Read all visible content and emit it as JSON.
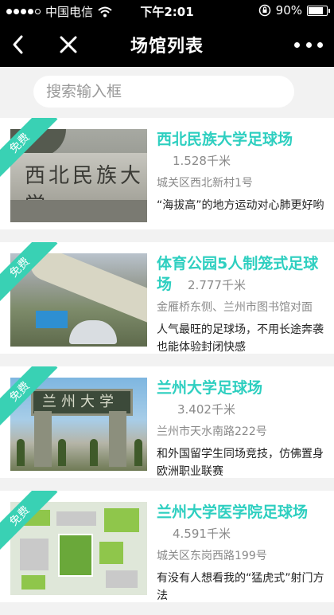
{
  "status_bar": {
    "carrier": "中国电信",
    "time": "下午2:01",
    "battery": "90%",
    "battery_level": 0.9
  },
  "nav": {
    "title": "场馆列表",
    "back_icon": "chevron-left-icon",
    "close_icon": "close-icon",
    "more_icon": "more-dots-icon"
  },
  "search": {
    "placeholder": "搜索输入框"
  },
  "colors": {
    "accent": "#2ecfc0",
    "ribbon": "#39d1b4",
    "navbar": "#000000"
  },
  "venues": [
    {
      "badge": "免费",
      "name": "西北民族大学足球场",
      "distance": "1.528千米",
      "address": "城关区西北新村1号",
      "description": "“海拔高”的地方运动对心肺更好哟"
    },
    {
      "badge": "免费",
      "name": "体育公园5人制笼式足球场",
      "distance": "2.777千米",
      "address": "金雁桥东侧、兰州市图书馆对面",
      "description": "人气最旺的足球场，不用长途奔袭也能体验封闭快感"
    },
    {
      "badge": "免费",
      "name": "兰州大学足球场",
      "distance": "3.402千米",
      "address": "兰州市天水南路222号",
      "description": "和外国留学生同场竞技，仿佛置身欧洲职业联赛"
    },
    {
      "badge": "免费",
      "name": "兰州大学医学院足球场",
      "distance": "4.591千米",
      "address": "城关区东岗西路199号",
      "description": "有没有人想看我的“猛虎式”射门方法"
    }
  ]
}
